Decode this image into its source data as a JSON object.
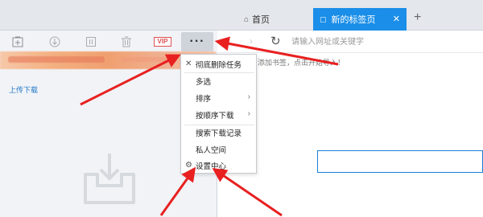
{
  "tabs": {
    "home_label": "首页",
    "active_label": "新的标签页",
    "close_glyph": "✕",
    "add_glyph": "+",
    "active_color": "#1a8ee8"
  },
  "toolbar": {
    "buttons": [
      "add-task-icon",
      "download-icon",
      "pause-icon",
      "delete-icon"
    ],
    "vip_label": "VIP",
    "more_label": "···"
  },
  "panel": {
    "upload_link": "上传下载"
  },
  "address": {
    "placeholder": "请输入网址或关键字",
    "bookmark_hint": "添加书签，点击开始导入！"
  },
  "context_menu": {
    "items": [
      {
        "label": "彻底删除任务",
        "lead": "✕",
        "has_submenu": false
      },
      {
        "label": "多选",
        "lead": "",
        "has_submenu": false
      },
      {
        "label": "排序",
        "lead": "",
        "has_submenu": true
      },
      {
        "label": "按顺序下载",
        "lead": "",
        "has_submenu": true
      },
      {
        "label": "搜索下载记录",
        "lead": "",
        "has_submenu": false
      },
      {
        "label": "私人空间",
        "lead": "",
        "has_submenu": false
      },
      {
        "label": "设置中心",
        "lead": "⚙",
        "has_submenu": false
      }
    ],
    "submenu_glyph": "›"
  },
  "annotation_color": "#e82020"
}
